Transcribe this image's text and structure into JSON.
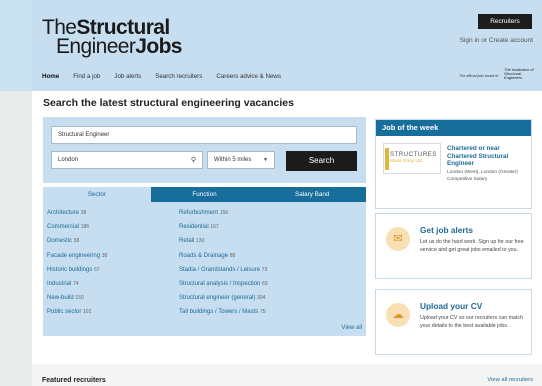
{
  "logo": {
    "line1_light": "The",
    "line1_bold": "Structural",
    "line2_light": "Engineer",
    "line2_bold": "Jobs"
  },
  "header": {
    "recruiters_button": "Recruiters",
    "sign_in": "Sign in",
    "or": "or",
    "create_account": "Create account",
    "tagline": "The official jobs board of",
    "institution_logo": "The Institution of Structural Engineers"
  },
  "nav": [
    "Home",
    "Find a job",
    "Job alerts",
    "Search recruiters",
    "Careers advice & News"
  ],
  "page_title": "Search the latest structural engineering vacancies",
  "search": {
    "keyword_value": "Structural Engineer",
    "location_value": "London",
    "radius_value": "Within 5 miles",
    "search_button": "Search"
  },
  "tabs": [
    "Sector",
    "Function",
    "Salary Band"
  ],
  "sectors_left": [
    {
      "label": "Architecture",
      "count": "38"
    },
    {
      "label": "Commercial",
      "count": "186"
    },
    {
      "label": "Domestic",
      "count": "58"
    },
    {
      "label": "Facade engineering",
      "count": "38"
    },
    {
      "label": "Historic buildings",
      "count": "67"
    },
    {
      "label": "Industrial",
      "count": "74"
    },
    {
      "label": "New-build",
      "count": "150"
    },
    {
      "label": "Public sector",
      "count": "102"
    }
  ],
  "sectors_right": [
    {
      "label": "Refurbishment",
      "count": "156"
    },
    {
      "label": "Residential",
      "count": "167"
    },
    {
      "label": "Retail",
      "count": "130"
    },
    {
      "label": "Roads & Drainage",
      "count": "88"
    },
    {
      "label": "Stadia / Grandstands / Leisure",
      "count": "73"
    },
    {
      "label": "Structural analysis / Inspection",
      "count": "69"
    },
    {
      "label": "Structural engineer (general)",
      "count": "304"
    },
    {
      "label": "Tall buildings / Towers / Masts",
      "count": "75"
    }
  ],
  "view_all": "View all",
  "job_of_week": {
    "heading": "Job of the week",
    "logo_name": "STRUCTURES",
    "logo_sub": "Made Easy Ltd",
    "title": "Chartered or near Chartered Structural Engineer",
    "location": "London (West), London (Greater)",
    "salary": "Competitive Salary"
  },
  "job_alerts": {
    "title": "Get job alerts",
    "text": "Let us do the hard work. Sign up for our free service and get great jobs emailed to you."
  },
  "upload_cv": {
    "title": "Upload your CV",
    "text": "Upload your CV so our recruiters can match your details to the best available jobs."
  },
  "featured": {
    "title": "Featured recruiters",
    "link": "View all recruiters"
  },
  "colors": {
    "accent": "#176e9b",
    "panel": "#c6def0",
    "link": "#1e6a96"
  }
}
